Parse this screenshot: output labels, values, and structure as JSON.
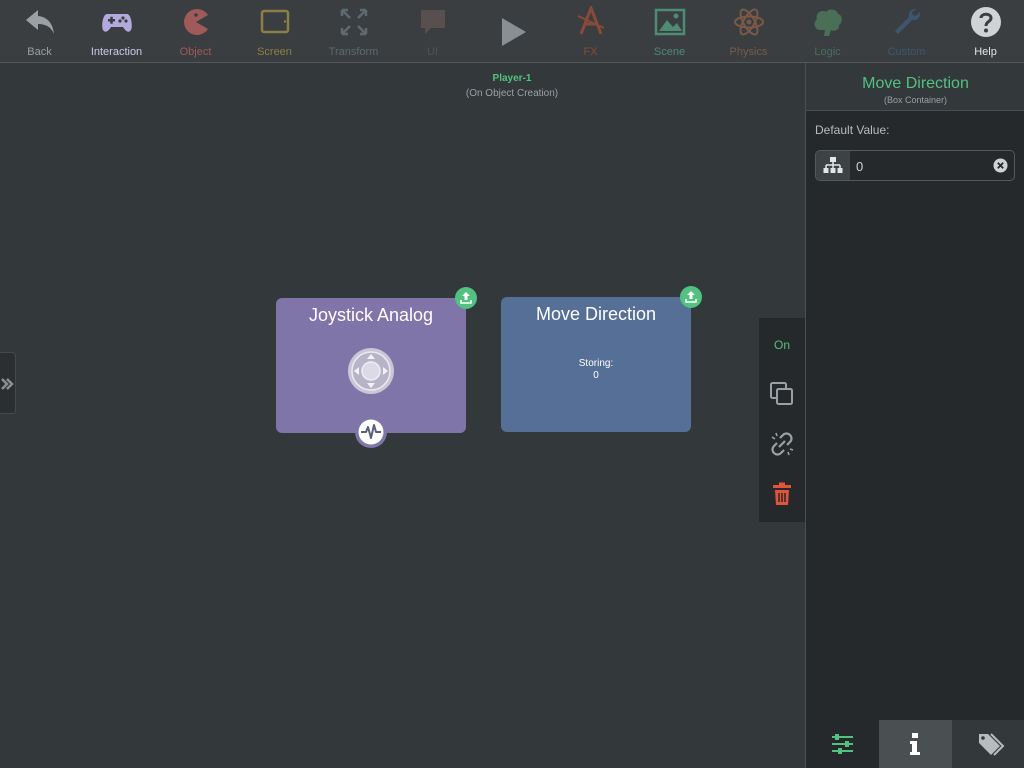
{
  "toolbar": {
    "items": [
      {
        "label": "Back",
        "icon": "back-arrow-icon",
        "color": "#9aa0a4"
      },
      {
        "label": "Interaction",
        "icon": "gamepad-icon",
        "color": "#b3aadb"
      },
      {
        "label": "Object",
        "icon": "pacman-icon",
        "color": "#a05a5a"
      },
      {
        "label": "Screen",
        "icon": "tablet-icon",
        "color": "#8c7f45"
      },
      {
        "label": "Transform",
        "icon": "arrows-expand-icon",
        "color": "#5e6a70"
      },
      {
        "label": "UI",
        "icon": "speech-bubble-icon",
        "color": "#5a4f4f"
      },
      {
        "label": "FX",
        "icon": "fx-icon",
        "color": "#8a4a3a"
      },
      {
        "label": "Scene",
        "icon": "landscape-image-icon",
        "color": "#4f8a72"
      },
      {
        "label": "Physics",
        "icon": "atom-icon",
        "color": "#7a5a46"
      },
      {
        "label": "Logic",
        "icon": "brain-icon",
        "color": "#4a6e56"
      },
      {
        "label": "Custom",
        "icon": "wrench-icon",
        "color": "#3c5670"
      },
      {
        "label": "Help",
        "icon": "question-icon",
        "color": "#cfd3d6"
      }
    ],
    "play_icon": "play-icon"
  },
  "canvas": {
    "object_name": "Player-1",
    "object_event": "(On Object Creation)",
    "nodes": {
      "joystick": {
        "title": "Joystick Analog",
        "color": "#7f75a8"
      },
      "move": {
        "title": "Move Direction",
        "storing_label": "Storing:",
        "storing_value": "0",
        "color": "#566f97"
      }
    }
  },
  "side_tools": {
    "on_label": "On",
    "items": [
      "copy-icon",
      "unlink-icon",
      "trash-icon"
    ]
  },
  "panel": {
    "title": "Move Direction",
    "subtitle": "(Box Container)",
    "default_value_label": "Default Value:",
    "default_value": "0",
    "tabs": [
      "sliders-icon",
      "info-icon",
      "tags-icon"
    ]
  },
  "colors": {
    "accent": "#53c180",
    "danger": "#e2533b"
  }
}
